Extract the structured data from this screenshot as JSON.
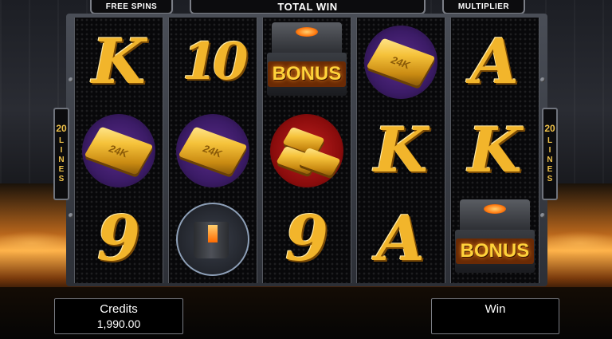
{
  "top_bar": {
    "free_spins_label": "FREE SPINS",
    "total_win_label": "TOTAL WIN",
    "multiplier_label": "MULTIPLIER"
  },
  "paylines": {
    "count": "20",
    "word_letters": [
      "L",
      "I",
      "N",
      "E",
      "S"
    ]
  },
  "reels": [
    [
      "K",
      "gold-bar-24k",
      "9"
    ],
    [
      "10",
      "gold-bar-24k",
      "molten-bucket"
    ],
    [
      "bonus",
      "gold-bars-stack",
      "9"
    ],
    [
      "gold-bar-24k",
      "K",
      "A"
    ],
    [
      "A",
      "K",
      "bonus"
    ]
  ],
  "symbols": {
    "bonus_text": "BONUS",
    "gold_bar_stamp": "24K",
    "letter_K": "K",
    "letter_10": "10",
    "letter_9": "9",
    "letter_A": "A"
  },
  "credits": {
    "label": "Credits",
    "value": "1,990.00"
  },
  "win": {
    "label": "Win",
    "value": ""
  },
  "colors": {
    "gold": "#f2b52b",
    "bonus_yellow": "#ffd23a",
    "purple_circle": "#5a2c8a",
    "red_circle": "#c12020"
  }
}
